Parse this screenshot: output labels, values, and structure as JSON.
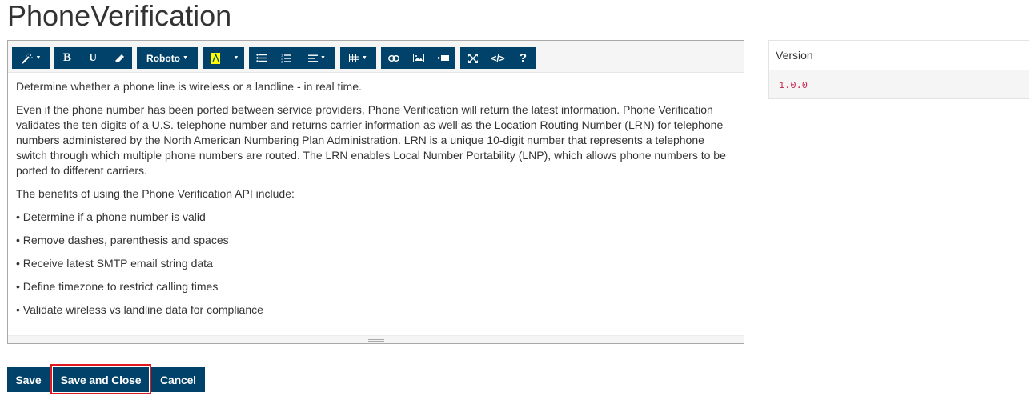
{
  "page": {
    "title": "PhoneVerification"
  },
  "toolbar": {
    "style_icon": "magic-wand-icon",
    "bold_label": "B",
    "underline_label": "U",
    "eraser_icon": "eraser-icon",
    "font_family_label": "Roboto",
    "color_icon": "text-color-icon",
    "unordered_list_icon": "unordered-list-icon",
    "ordered_list_icon": "ordered-list-icon",
    "paragraph_icon": "align-left-icon",
    "table_icon": "table-icon",
    "link_icon": "link-icon",
    "picture_icon": "picture-icon",
    "video_icon": "video-icon",
    "fullscreen_icon": "fullscreen-icon",
    "codeview_label": "</>",
    "help_label": "?",
    "color_highlight": "#ffff00"
  },
  "content": {
    "paragraphs": [
      "Determine whether a phone line is wireless or a landline - in real time.",
      "Even if the phone number has been ported between service providers, Phone Verification will return the latest information. Phone Verification validates the ten digits of a U.S. telephone number and returns carrier information as well as the Location Routing Number (LRN) for telephone numbers administered by the North American Numbering Plan Administration. LRN is a unique 10-digit number that represents a telephone switch through which multiple phone numbers are routed. The LRN enables Local Number Portability (LNP), which allows phone numbers to be ported to different carriers.",
      "The benefits of using the Phone Verification API include:",
      "• Determine if a phone number is valid",
      "• Remove dashes, parenthesis and spaces",
      "• Receive latest SMTP email string data",
      "• Define timezone to restrict calling times",
      "• Validate wireless vs landline data for compliance"
    ]
  },
  "version": {
    "label": "Version",
    "value": "1.0.0"
  },
  "actions": {
    "save_label": "Save",
    "save_close_label": "Save and Close",
    "cancel_label": "Cancel"
  },
  "colors": {
    "brand": "#01426a",
    "highlight_border": "#e0191f",
    "version_text": "#c7254e"
  }
}
